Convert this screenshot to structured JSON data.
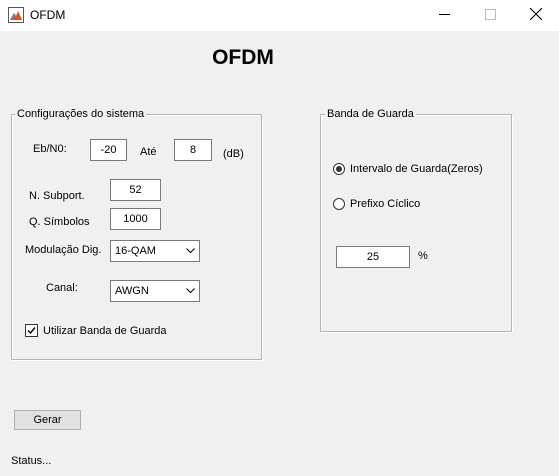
{
  "window": {
    "title": "OFDM",
    "icon": "matlab-figure-icon",
    "controls": [
      "minimize-icon",
      "maximize-icon",
      "close-icon"
    ]
  },
  "heading": "OFDM",
  "system_panel": {
    "title": "Configurações do sistema",
    "ebn0_label": "Eb/N0:",
    "ebn0_from": "-20",
    "until_label": "Até",
    "ebn0_to": "8",
    "unit_label": "(dB)",
    "subcarriers_label": "N. Subport.",
    "subcarriers_value": "52",
    "symbols_label": "Q. Símbolos",
    "symbols_value": "1000",
    "modulation_label": "Modulação Dig.",
    "modulation_value": "16-QAM",
    "channel_label": "Canal:",
    "channel_value": "AWGN",
    "guard_checkbox_label": "Utilizar Banda de Guarda",
    "guard_checkbox_checked": true
  },
  "guard_panel": {
    "title": "Banda de Guarda",
    "option_interval": "Intervalo de Guarda(Zeros)",
    "option_prefix": "Prefixo Cíclico",
    "selected_option": "Intervalo de Guarda(Zeros)",
    "percent_value": "25",
    "percent_label": "%"
  },
  "generate_button": "Gerar",
  "status": "Status..."
}
